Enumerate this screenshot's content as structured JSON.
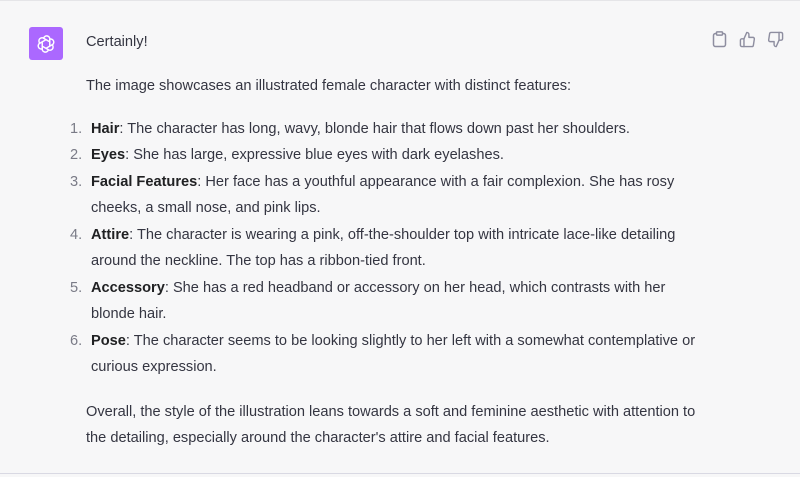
{
  "message": {
    "greeting": "Certainly!",
    "intro": "The image showcases an illustrated female character with distinct features:",
    "items": [
      {
        "num": "1.",
        "title": "Hair",
        "text": ": The character has long, wavy, blonde hair that flows down past her shoulders."
      },
      {
        "num": "2.",
        "title": "Eyes",
        "text": ": She has large, expressive blue eyes with dark eyelashes."
      },
      {
        "num": "3.",
        "title": "Facial Features",
        "text": ": Her face has a youthful appearance with a fair complexion. She has rosy cheeks, a small nose, and pink lips."
      },
      {
        "num": "4.",
        "title": "Attire",
        "text": ": The character is wearing a pink, off-the-shoulder top with intricate lace-like detailing around the neckline. The top has a ribbon-tied front."
      },
      {
        "num": "5.",
        "title": "Accessory",
        "text": ": She has a red headband or accessory on her head, which contrasts with her blonde hair."
      },
      {
        "num": "6.",
        "title": "Pose",
        "text": ": The character seems to be looking slightly to her left with a somewhat contemplative or curious expression."
      }
    ],
    "outro": "Overall, the style of the illustration leans towards a soft and feminine aesthetic with attention to the detailing, especially around the character's attire and facial features."
  },
  "avatar": {
    "icon": "openai-logo-icon",
    "color": "#ab68ff"
  },
  "actions": [
    {
      "icon": "clipboard-icon"
    },
    {
      "icon": "thumbs-up-icon"
    },
    {
      "icon": "thumbs-down-icon"
    }
  ],
  "colors": {
    "background": "#f7f7f8",
    "text": "#343541",
    "muted": "#7a7b87"
  }
}
